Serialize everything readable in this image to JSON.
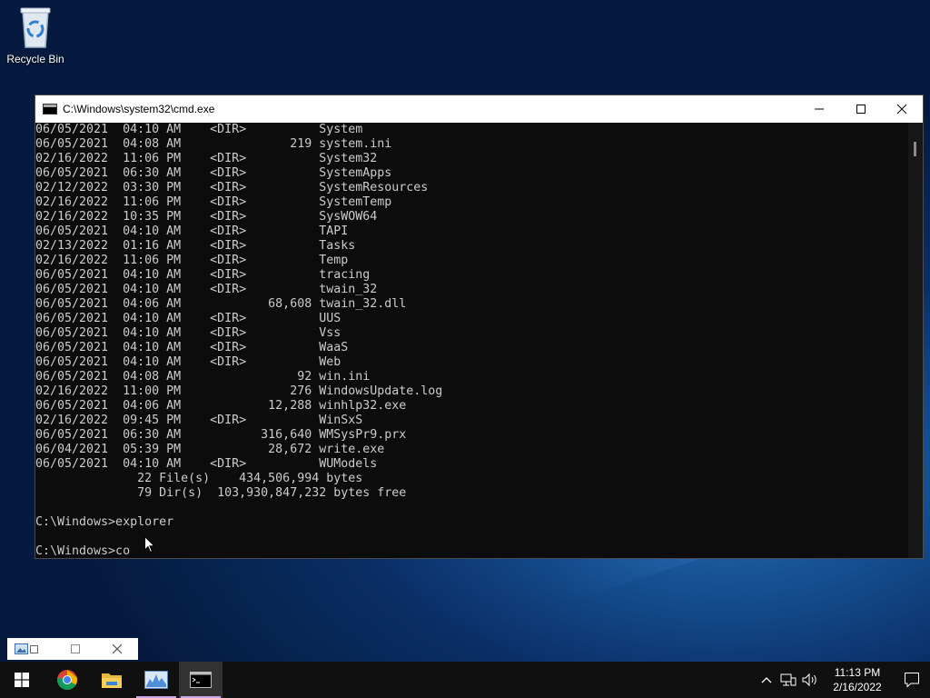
{
  "desktop": {
    "icons": [
      {
        "label": "Recycle Bin",
        "icon": "recycle-bin-icon"
      }
    ]
  },
  "cmd_window": {
    "title": "C:\\Windows\\system32\\cmd.exe",
    "lines": [
      "06/05/2021  04:10 AM    <DIR>          System",
      "06/05/2021  04:08 AM               219 system.ini",
      "02/16/2022  11:06 PM    <DIR>          System32",
      "06/05/2021  06:30 AM    <DIR>          SystemApps",
      "02/12/2022  03:30 PM    <DIR>          SystemResources",
      "02/16/2022  11:06 PM    <DIR>          SystemTemp",
      "02/16/2022  10:35 PM    <DIR>          SysWOW64",
      "06/05/2021  04:10 AM    <DIR>          TAPI",
      "02/13/2022  01:16 AM    <DIR>          Tasks",
      "02/16/2022  11:06 PM    <DIR>          Temp",
      "06/05/2021  04:10 AM    <DIR>          tracing",
      "06/05/2021  04:10 AM    <DIR>          twain_32",
      "06/05/2021  04:06 AM            68,608 twain_32.dll",
      "06/05/2021  04:10 AM    <DIR>          UUS",
      "06/05/2021  04:10 AM    <DIR>          Vss",
      "06/05/2021  04:10 AM    <DIR>          WaaS",
      "06/05/2021  04:10 AM    <DIR>          Web",
      "06/05/2021  04:08 AM                92 win.ini",
      "02/16/2022  11:00 PM               276 WindowsUpdate.log",
      "06/05/2021  04:06 AM            12,288 winhlp32.exe",
      "02/16/2022  09:45 PM    <DIR>          WinSxS",
      "06/05/2021  06:30 AM           316,640 WMSysPr9.prx",
      "06/04/2021  05:39 PM            28,672 write.exe",
      "06/05/2021  04:10 AM    <DIR>          WUModels",
      "              22 File(s)    434,506,994 bytes",
      "              79 Dir(s)  103,930,847,232 bytes free",
      "",
      "C:\\Windows>explorer",
      "",
      "C:\\Windows>co"
    ]
  },
  "mini_window": {
    "icon": "image-viewer-icon"
  },
  "taskbar": {
    "apps": [
      {
        "name": "start",
        "icon": "windows-start-icon"
      },
      {
        "name": "chrome",
        "icon": "chrome-icon"
      },
      {
        "name": "file-explorer",
        "icon": "folder-icon"
      },
      {
        "name": "resource-monitor",
        "icon": "performance-monitor-icon"
      },
      {
        "name": "command-prompt",
        "icon": "command-prompt-icon"
      }
    ],
    "clock_time": "11:13 PM",
    "clock_date": "2/16/2022"
  },
  "colors": {
    "console_bg": "#0c0c0c",
    "console_text": "#cccccc",
    "taskbar_bg": "#101010",
    "running_indicator": "#c9a6e6"
  }
}
